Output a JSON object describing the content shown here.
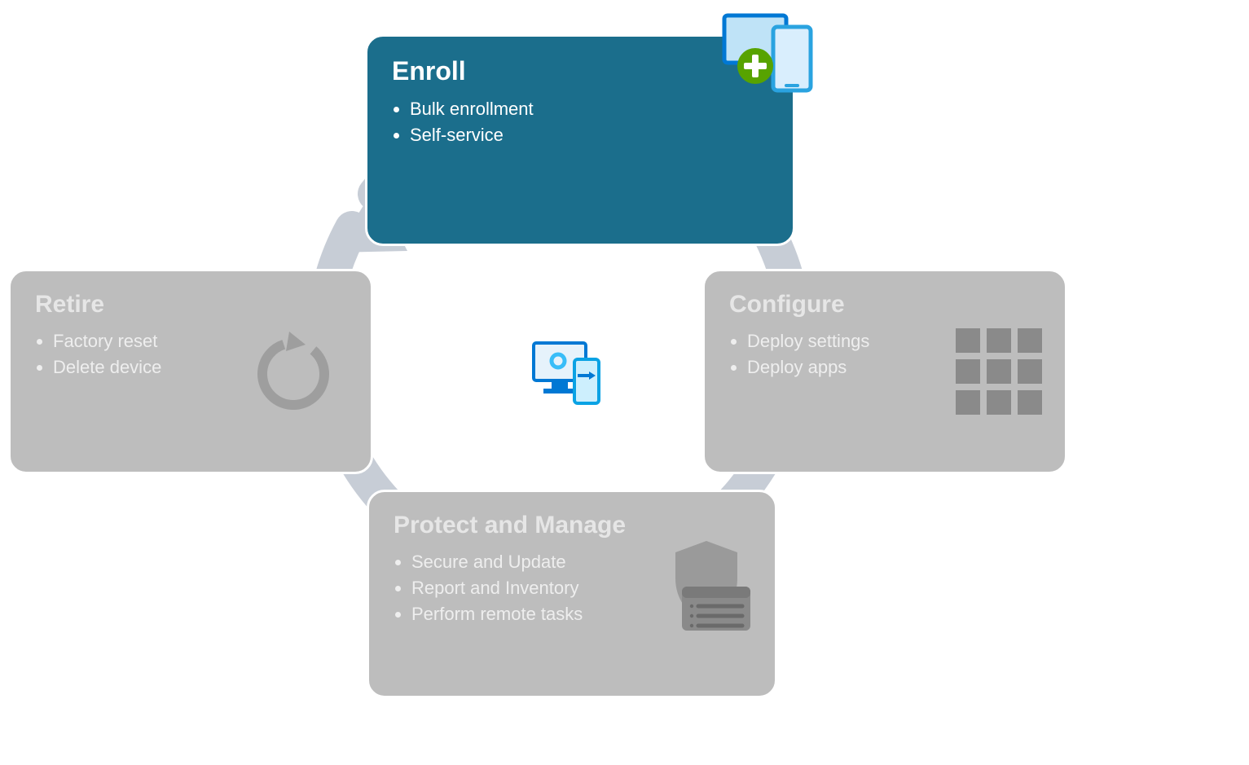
{
  "cycle": {
    "enroll": {
      "title": "Enroll",
      "items": [
        "Bulk enrollment",
        "Self-service"
      ]
    },
    "configure": {
      "title": "Configure",
      "items": [
        "Deploy settings",
        "Deploy apps"
      ]
    },
    "protect": {
      "title": "Protect and Manage",
      "items": [
        "Secure and Update",
        "Report and Inventory",
        "Perform remote tasks"
      ]
    },
    "retire": {
      "title": "Retire",
      "items": [
        "Factory reset",
        "Delete device"
      ]
    }
  },
  "colors": {
    "active_bg": "#1b6e8c",
    "inactive_bg": "#bdbdbd",
    "ring": "#c7cdd6",
    "accent_green": "#57a300",
    "accent_blue": "#0078d4"
  }
}
